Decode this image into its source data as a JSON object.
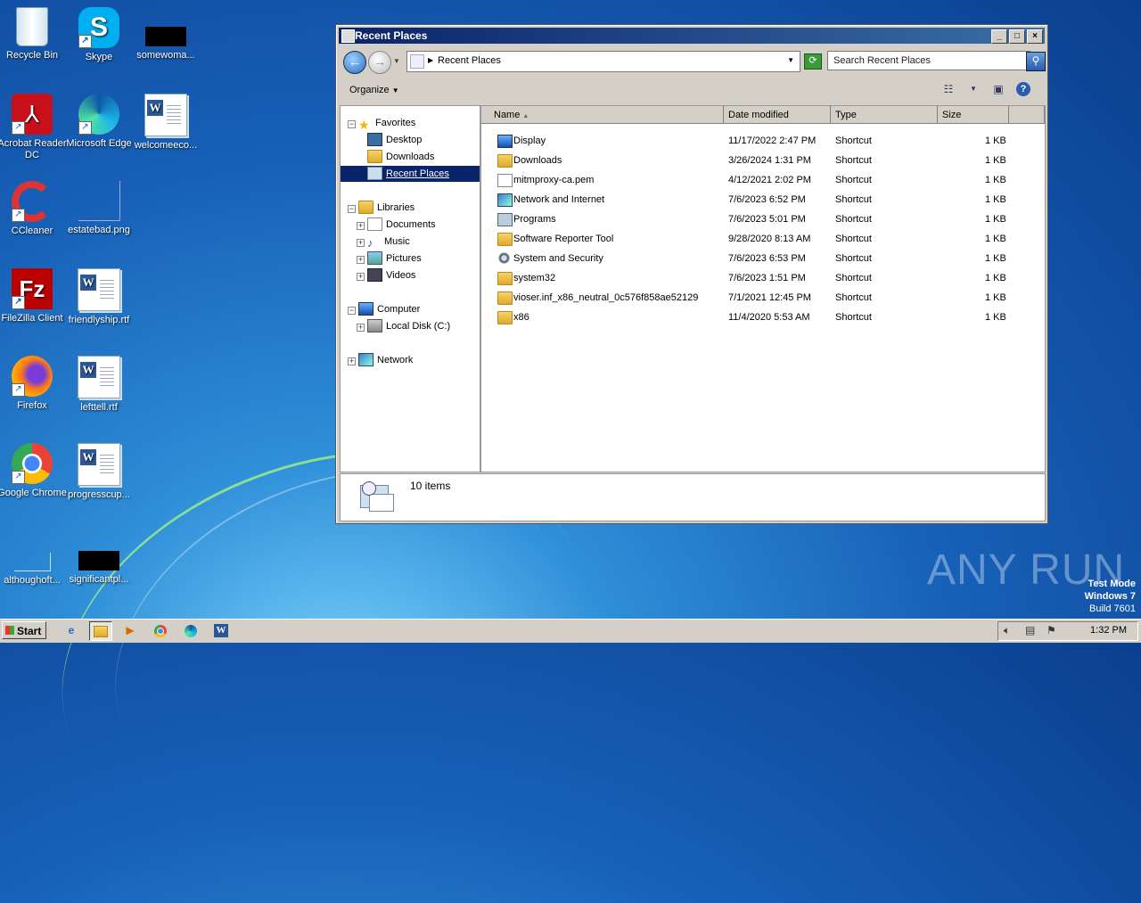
{
  "desktop": {
    "icons": [
      {
        "label": "Recycle Bin"
      },
      {
        "label": "Skype"
      },
      {
        "label": "somewoma..."
      },
      {
        "label": "Acrobat Reader DC"
      },
      {
        "label": "Microsoft Edge"
      },
      {
        "label": "welcomeeco..."
      },
      {
        "label": "CCleaner"
      },
      {
        "label": "estatebad.png"
      },
      {
        "label": "FileZilla Client"
      },
      {
        "label": "friendlyship.rtf"
      },
      {
        "label": "Firefox"
      },
      {
        "label": "lefttell.rtf"
      },
      {
        "label": "Google Chrome"
      },
      {
        "label": "progresscup..."
      },
      {
        "label": "althoughoft..."
      },
      {
        "label": "significantpl..."
      }
    ],
    "watermark": "ANY RUN",
    "test_mode": {
      "line1": "Test Mode",
      "line2": "Windows 7",
      "line3": "Build 7601"
    }
  },
  "window": {
    "title": "Recent Places",
    "minimize": "_",
    "maximize": "□",
    "close": "×",
    "address": "Recent Places",
    "search_placeholder": "Search Recent Places",
    "organize": "Organize",
    "nav": {
      "favorites": "Favorites",
      "desktop": "Desktop",
      "downloads": "Downloads",
      "recent_places": "Recent Places",
      "libraries": "Libraries",
      "documents": "Documents",
      "music": "Music",
      "pictures": "Pictures",
      "videos": "Videos",
      "computer": "Computer",
      "local_disk": "Local Disk (C:)",
      "network": "Network"
    },
    "columns": {
      "name": "Name",
      "date": "Date modified",
      "type": "Type",
      "size": "Size"
    },
    "files": [
      {
        "name": "Display",
        "date": "11/17/2022 2:47 PM",
        "type": "Shortcut",
        "size": "1 KB",
        "icon": "monitor"
      },
      {
        "name": "Downloads",
        "date": "3/26/2024 1:31 PM",
        "type": "Shortcut",
        "size": "1 KB",
        "icon": "folder"
      },
      {
        "name": "mitmproxy-ca.pem",
        "date": "4/12/2021 2:02 PM",
        "type": "Shortcut",
        "size": "1 KB",
        "icon": "file"
      },
      {
        "name": "Network and Internet",
        "date": "7/6/2023 6:52 PM",
        "type": "Shortcut",
        "size": "1 KB",
        "icon": "network"
      },
      {
        "name": "Programs",
        "date": "7/6/2023 5:01 PM",
        "type": "Shortcut",
        "size": "1 KB",
        "icon": "programs"
      },
      {
        "name": "Software Reporter Tool",
        "date": "9/28/2020 8:13 AM",
        "type": "Shortcut",
        "size": "1 KB",
        "icon": "folder"
      },
      {
        "name": "System and Security",
        "date": "7/6/2023 6:53 PM",
        "type": "Shortcut",
        "size": "1 KB",
        "icon": "gear"
      },
      {
        "name": "system32",
        "date": "7/6/2023 1:51 PM",
        "type": "Shortcut",
        "size": "1 KB",
        "icon": "folder"
      },
      {
        "name": "vioser.inf_x86_neutral_0c576f858ae52129",
        "date": "7/1/2021 12:45 PM",
        "type": "Shortcut",
        "size": "1 KB",
        "icon": "folder"
      },
      {
        "name": "x86",
        "date": "11/4/2020 5:53 AM",
        "type": "Shortcut",
        "size": "1 KB",
        "icon": "folder"
      }
    ],
    "item_count": "10 items"
  },
  "taskbar": {
    "start": "Start",
    "clock": "1:32 PM"
  }
}
